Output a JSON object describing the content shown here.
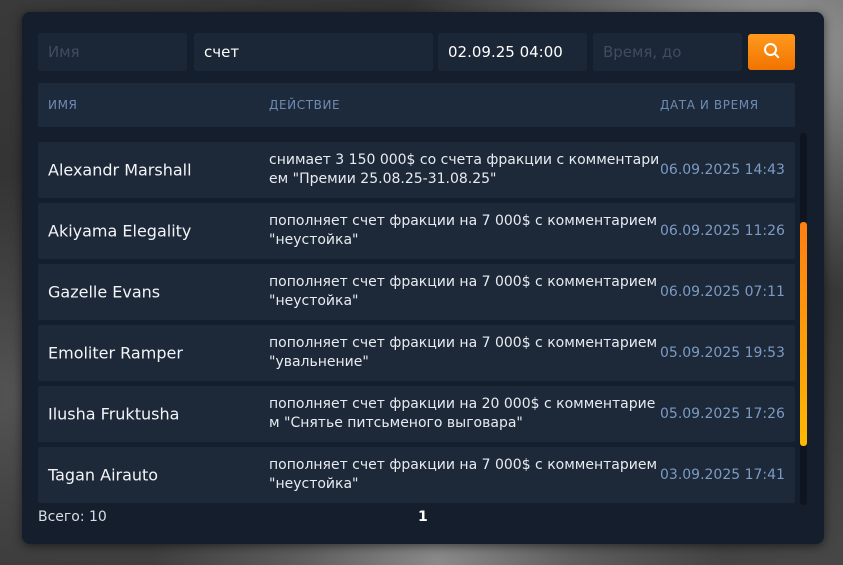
{
  "filters": {
    "name_placeholder": "Имя",
    "action_value": "счет",
    "date_from_value": "02.09.25 04:00",
    "date_to_placeholder": "Время, до",
    "search_icon": "search-icon",
    "accent_color": "#f58a0c"
  },
  "table": {
    "headers": {
      "name": "ИМЯ",
      "action": "ДЕЙСТВИЕ",
      "date": "ДАТА И ВРЕМЯ"
    },
    "rows": [
      {
        "name": "Alexandr Marshall",
        "action": "снимает 3 150 000$ со счета фракции с комментарием \"Премии 25.08.25-31.08.25\"",
        "date": "06.09.2025 14:43"
      },
      {
        "name": "Akiyama Elegality",
        "action": "пополняет счет фракции на 7 000$ с комментарием \"неустойка\"",
        "date": "06.09.2025 11:26"
      },
      {
        "name": "Gazelle Evans",
        "action": "пополняет счет фракции на 7 000$ с комментарием \"неустойка\"",
        "date": "06.09.2025 07:11"
      },
      {
        "name": "Emoliter Ramper",
        "action": "пополняет счет фракции на 7 000$ с комментарием \"увальнение\"",
        "date": "05.09.2025 19:53"
      },
      {
        "name": "Ilusha Fruktusha",
        "action": "пополняет счет фракции на 20 000$ с комментарием \"Снятье питсьменого выговара\"",
        "date": "05.09.2025 17:26"
      },
      {
        "name": "Tagan Airauto",
        "action": "пополняет счет фракции на 7 000$ с комментарием \"неустойка\"",
        "date": "03.09.2025 17:41"
      }
    ]
  },
  "scroll": {
    "position": 0.6
  },
  "footer": {
    "total_label": "Всего: 10",
    "page": "1"
  }
}
